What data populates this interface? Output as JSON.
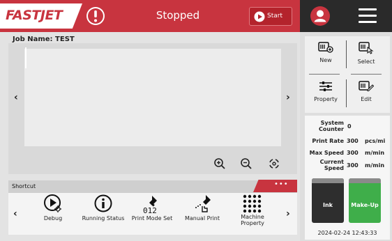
{
  "brand": {
    "logo_text": "FASTJET",
    "accent": "#c8343f"
  },
  "header": {
    "status": "Stopped",
    "start_label": "Start",
    "alert_icon": "exclamation-circle-icon",
    "user_icon": "user-icon",
    "menu_icon": "hamburger-menu-icon"
  },
  "job": {
    "label": "Job Name:",
    "name": "TEST"
  },
  "preview": {
    "prev_arrow": "‹",
    "next_arrow": "›",
    "zoom_in_icon": "zoom-in-icon",
    "zoom_out_icon": "zoom-out-icon",
    "fit_icon": "fit-view-icon"
  },
  "shortcut": {
    "title": "Shortcut",
    "more": "•••",
    "prev_arrow": "‹",
    "next_arrow": "›",
    "items": [
      {
        "label": "Debug",
        "icon": "debug-play-icon"
      },
      {
        "label": "Running Status",
        "icon": "info-icon"
      },
      {
        "label": "Print Mode Set",
        "icon": "print-mode-icon"
      },
      {
        "label": "Manual Print",
        "icon": "manual-print-icon"
      },
      {
        "label": "Machine\nProperty",
        "icon": "machine-property-icon"
      }
    ]
  },
  "tools": [
    {
      "label": "New",
      "icon": "new-file-icon"
    },
    {
      "label": "Select",
      "icon": "select-file-icon"
    },
    {
      "label": "Property",
      "icon": "sliders-icon"
    },
    {
      "label": "Edit",
      "icon": "edit-file-icon"
    }
  ],
  "info": {
    "system_counter": {
      "label": "System Counter",
      "value": "0"
    },
    "print_rate": {
      "label": "Print Rate",
      "value": "300",
      "unit": "pcs/mi"
    },
    "max_speed": {
      "label": "Max Speed",
      "value": "300",
      "unit": "m/min"
    },
    "current_speed": {
      "label": "Current Speed",
      "value": "300",
      "unit": "m/min"
    }
  },
  "levels": {
    "ink": {
      "label": "Ink",
      "color": "#2e2e2e"
    },
    "makeup": {
      "label": "Make-Up",
      "color": "#3fae4a"
    }
  },
  "datetime": "2024-02-24 12:43:33"
}
